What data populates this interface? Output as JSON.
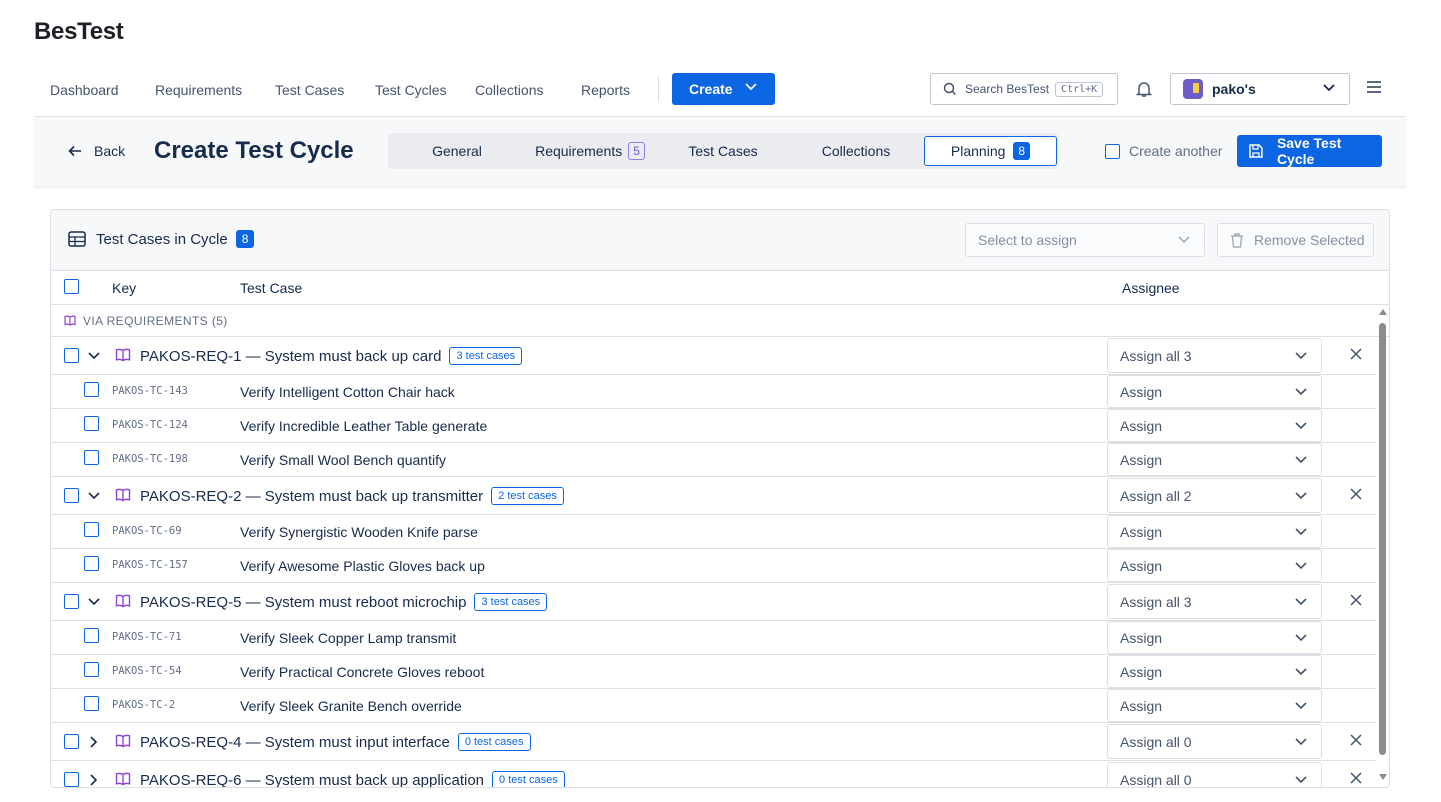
{
  "app": {
    "title": "BesTest"
  },
  "nav": {
    "items": [
      "Dashboard",
      "Requirements",
      "Test Cases",
      "Test Cycles",
      "Collections",
      "Reports"
    ],
    "create_label": "Create",
    "search_placeholder": "Search BesTest",
    "search_shortcut": "Ctrl+K",
    "workspace": "pako's"
  },
  "header": {
    "back_label": "Back",
    "page_title": "Create Test Cycle",
    "tabs": [
      {
        "label": "General",
        "badge": ""
      },
      {
        "label": "Requirements",
        "badge": "5"
      },
      {
        "label": "Test Cases",
        "badge": ""
      },
      {
        "label": "Collections",
        "badge": ""
      },
      {
        "label": "Planning",
        "badge": "8"
      }
    ],
    "active_tab": "Planning",
    "create_another_label": "Create another",
    "save_label": "Save Test Cycle"
  },
  "panel": {
    "title": "Test Cases in Cycle",
    "count": "8",
    "assign_placeholder": "Select to assign",
    "remove_label": "Remove Selected",
    "columns": {
      "key": "Key",
      "test_case": "Test Case",
      "assignee": "Assignee"
    },
    "section_label": "VIA REQUIREMENTS (5)",
    "requirements": [
      {
        "title": "PAKOS-REQ-1 — System must back up card",
        "badge": "3 test cases",
        "assign": "Assign all 3",
        "expanded": true,
        "cases": [
          {
            "key": "PAKOS-TC-143",
            "name": "Verify Intelligent Cotton Chair hack",
            "assign": "Assign"
          },
          {
            "key": "PAKOS-TC-124",
            "name": "Verify Incredible Leather Table generate",
            "assign": "Assign"
          },
          {
            "key": "PAKOS-TC-198",
            "name": "Verify Small Wool Bench quantify",
            "assign": "Assign"
          }
        ]
      },
      {
        "title": "PAKOS-REQ-2 — System must back up transmitter",
        "badge": "2 test cases",
        "assign": "Assign all 2",
        "expanded": true,
        "cases": [
          {
            "key": "PAKOS-TC-69",
            "name": "Verify Synergistic Wooden Knife parse",
            "assign": "Assign"
          },
          {
            "key": "PAKOS-TC-157",
            "name": "Verify Awesome Plastic Gloves back up",
            "assign": "Assign"
          }
        ]
      },
      {
        "title": "PAKOS-REQ-5 — System must reboot microchip",
        "badge": "3 test cases",
        "assign": "Assign all 3",
        "expanded": true,
        "cases": [
          {
            "key": "PAKOS-TC-71",
            "name": "Verify Sleek Copper Lamp transmit",
            "assign": "Assign"
          },
          {
            "key": "PAKOS-TC-54",
            "name": "Verify Practical Concrete Gloves reboot",
            "assign": "Assign"
          },
          {
            "key": "PAKOS-TC-2",
            "name": "Verify Sleek Granite Bench override",
            "assign": "Assign"
          }
        ]
      },
      {
        "title": "PAKOS-REQ-4 — System must input interface",
        "badge": "0 test cases",
        "assign": "Assign all 0",
        "expanded": false,
        "cases": []
      },
      {
        "title": "PAKOS-REQ-6 — System must back up application",
        "badge": "0 test cases",
        "assign": "Assign all 0",
        "expanded": false,
        "cases": []
      }
    ]
  },
  "colors": {
    "accent": "#0c66e4",
    "requirement_icon": "#8f46d4",
    "border": "#dcdfe4"
  },
  "icons": {
    "search": "search-icon",
    "bell": "bell-icon",
    "menu": "hamburger-icon",
    "back": "arrow-left-icon",
    "save": "save-icon",
    "trash": "trash-icon",
    "table": "table-icon",
    "requirement": "book-icon",
    "remove": "close-icon"
  }
}
